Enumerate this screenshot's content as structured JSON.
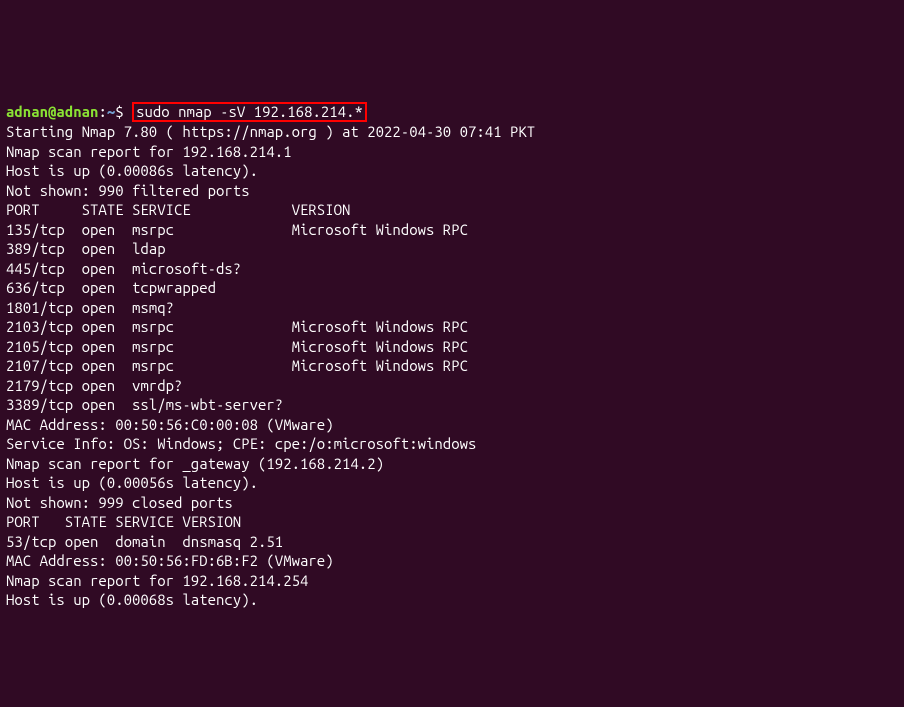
{
  "truncated_top": "                                                           ",
  "prompt": {
    "user": "adnan",
    "at": "@",
    "host": "adnan",
    "colon": ":",
    "path": "~",
    "dollar": "$ "
  },
  "command": "sudo nmap -sV 192.168.214.*",
  "output": {
    "start": "Starting Nmap 7.80 ( https://nmap.org ) at 2022-04-30 07:41 PKT",
    "host1": {
      "report": "Nmap scan report for 192.168.214.1",
      "up": "Host is up (0.00086s latency).",
      "notshown": "Not shown: 990 filtered ports",
      "header": "PORT     STATE SERVICE            VERSION",
      "rows": [
        "135/tcp  open  msrpc              Microsoft Windows RPC",
        "389/tcp  open  ldap",
        "445/tcp  open  microsoft-ds?",
        "636/tcp  open  tcpwrapped",
        "1801/tcp open  msmq?",
        "2103/tcp open  msrpc              Microsoft Windows RPC",
        "2105/tcp open  msrpc              Microsoft Windows RPC",
        "2107/tcp open  msrpc              Microsoft Windows RPC",
        "2179/tcp open  vmrdp?",
        "3389/tcp open  ssl/ms-wbt-server?"
      ],
      "mac": "MAC Address: 00:50:56:C0:00:08 (VMware)",
      "svcinfo": "Service Info: OS: Windows; CPE: cpe:/o:microsoft:windows"
    },
    "blank1": "",
    "host2": {
      "report": "Nmap scan report for _gateway (192.168.214.2)",
      "up": "Host is up (0.00056s latency).",
      "notshown": "Not shown: 999 closed ports",
      "header": "PORT   STATE SERVICE VERSION",
      "rows": [
        "53/tcp open  domain  dnsmasq 2.51"
      ],
      "mac": "MAC Address: 00:50:56:FD:6B:F2 (VMware)"
    },
    "blank2": "",
    "host3": {
      "report": "Nmap scan report for 192.168.214.254",
      "up": "Host is up (0.00068s latency)."
    }
  }
}
